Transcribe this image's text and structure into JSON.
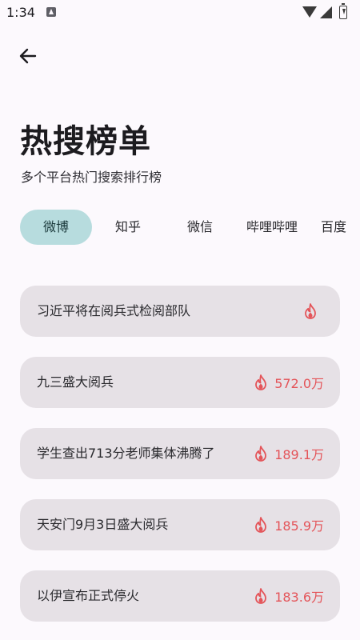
{
  "status_bar": {
    "time": "1:34"
  },
  "header": {
    "title": "热搜榜单",
    "subtitle": "多个平台热门搜索排行榜"
  },
  "tabs": [
    {
      "label": "微博",
      "active": true
    },
    {
      "label": "知乎"
    },
    {
      "label": "微信"
    },
    {
      "label": "哔哩哔哩"
    },
    {
      "label": "百度"
    }
  ],
  "hot_list": [
    {
      "title": "习近平将在阅兵式检阅部队",
      "count": ""
    },
    {
      "title": "九三盛大阅兵",
      "count": "572.0万"
    },
    {
      "title": "学生查出713分老师集体沸腾了",
      "count": "189.1万"
    },
    {
      "title": "天安门9月3日盛大阅兵",
      "count": "185.9万"
    },
    {
      "title": "以伊宣布正式停火",
      "count": "183.6万"
    }
  ],
  "colors": {
    "background": "#fcf9fd",
    "active_tab": "#b7dcde",
    "card": "#e6e1e6",
    "hot_accent": "#e45459"
  },
  "icons": {
    "back": "arrow-left-icon",
    "hot": "fire-icon"
  }
}
